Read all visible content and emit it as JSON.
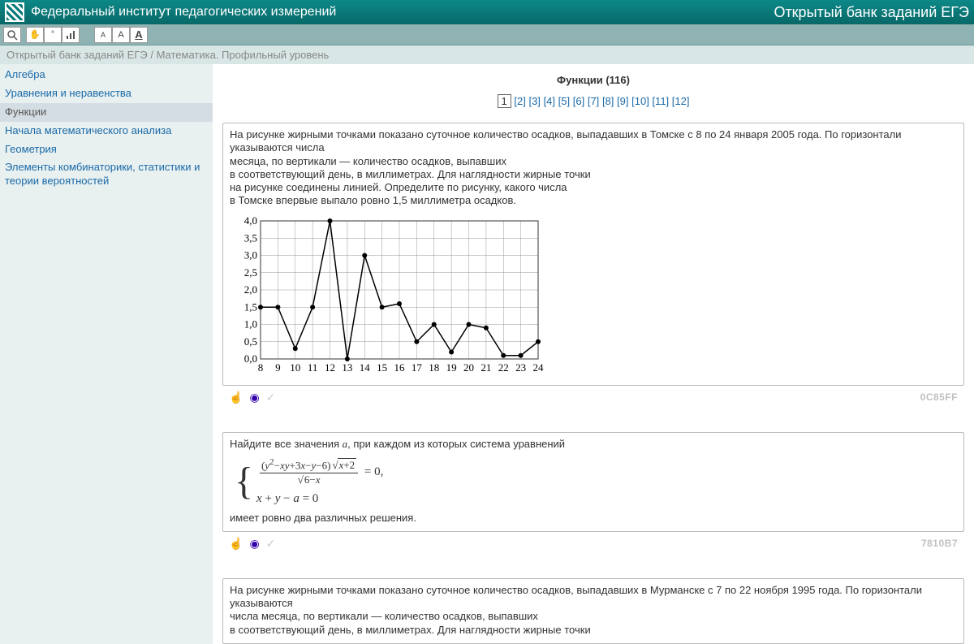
{
  "header": {
    "institute": "Федеральный институт педагогических измерений",
    "product": "Открытый банк заданий ЕГЭ"
  },
  "breadcrumb": "Открытый банк заданий ЕГЭ / Математика. Профильный уровень",
  "sidebar": {
    "items": [
      {
        "label": "Алгебра"
      },
      {
        "label": "Уравнения и неравенства"
      },
      {
        "label": "Функции",
        "active": true
      },
      {
        "label": "Начала математического анализа"
      },
      {
        "label": "Геометрия"
      },
      {
        "label": "Элементы комбинаторики, статистики и теории вероятностей"
      }
    ]
  },
  "page": {
    "title": "Функции (116)",
    "current_page": "1",
    "pages": [
      "2",
      "3",
      "4",
      "5",
      "6",
      "7",
      "8",
      "9",
      "10",
      "11",
      "12"
    ]
  },
  "tasks": {
    "t1": {
      "text_l1": "На рисунке жирными точками показано суточное количество осадков, выпадавших в Томске с 8 по 24 января 2005 года. По горизонтали указываются числа",
      "text_l2": "месяца, по вертикали — количество осадков, выпавших",
      "text_l3": "в соответствующий день, в миллиметрах. Для наглядности жирные точки",
      "text_l4": "на рисунке соединены линией. Определите по рисунку, какого числа",
      "text_l5": "в Томске впервые выпало ровно 1,5 миллиметра осадков.",
      "code": "0C85FF"
    },
    "t2": {
      "intro": "Найдите все значения ",
      "param": "a",
      "intro2": ", при каждом из которых система уравнений",
      "outro": "имеет ровно два различных решения.",
      "code": "7810B7"
    },
    "t3": {
      "text_l1": "На рисунке жирными точками показано суточное количество осадков, выпадавших в Мурманске с 7 по 22 ноября 1995 года. По горизонтали указываются",
      "text_l2": "числа месяца, по вертикали — количество осадков, выпавших",
      "text_l3": "в соответствующий день, в миллиметрах. Для наглядности жирные точки"
    }
  },
  "chart_data": {
    "type": "line",
    "title": "",
    "xlabel": "",
    "ylabel": "",
    "x": [
      8,
      9,
      10,
      11,
      12,
      13,
      14,
      15,
      16,
      17,
      18,
      19,
      20,
      21,
      22,
      23,
      24
    ],
    "y": [
      1.5,
      1.5,
      0.3,
      1.5,
      4.0,
      0.0,
      3.0,
      1.5,
      1.6,
      0.5,
      1.0,
      0.2,
      1.0,
      0.9,
      0.1,
      0.1,
      0.5
    ],
    "y_ticks": [
      "0,0",
      "0,5",
      "1,0",
      "1,5",
      "2,0",
      "2,5",
      "3,0",
      "3,5",
      "4,0"
    ],
    "ylim": [
      0.0,
      4.0
    ],
    "xlim": [
      8,
      24
    ]
  }
}
